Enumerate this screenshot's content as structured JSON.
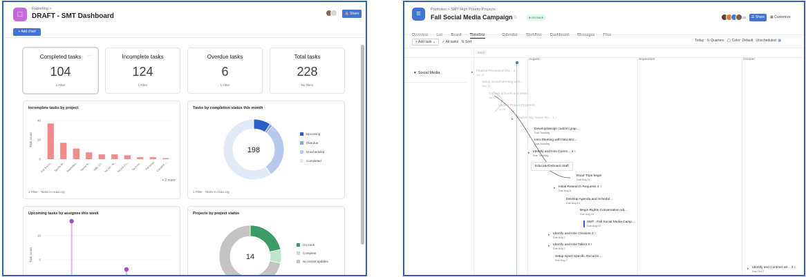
{
  "dashboard": {
    "breadcrumb": "Reporting >",
    "title": "DRAFT - SMT Dashboard",
    "share_label": "Share",
    "add_chart_label": "+ Add chart",
    "stats": [
      {
        "label": "Completed tasks",
        "value": "104",
        "filter": "1 Filter"
      },
      {
        "label": "Incomplete tasks",
        "value": "124",
        "filter": "1 Filter"
      },
      {
        "label": "Overdue tasks",
        "value": "6",
        "filter": "1 Filter"
      },
      {
        "label": "Total tasks",
        "value": "228",
        "filter": "No filters"
      }
    ],
    "incomplete_card": {
      "title": "Incomplete tasks by project",
      "footer": "1 Filter · Tasks in ncaa.org",
      "more": "+ 2 more"
    },
    "status_card": {
      "title": "Tasks by completion status this month",
      "footer": "1 Filter · Tasks in ncaa.org"
    },
    "upcoming_card": {
      "title": "Upcoming tasks by assignee this week"
    },
    "projects_card": {
      "title": "Projects by project status"
    }
  },
  "chart_data": [
    {
      "type": "bar",
      "title": "Incomplete tasks by project",
      "ylabel": "Task count",
      "ylim": [
        0,
        40
      ],
      "yticks": [
        0,
        20,
        40
      ],
      "categories": [
        "Fall Socia...",
        "Sports M...",
        "Basketba...",
        "Name N...",
        "NBL Co...",
        "NCAA - N...",
        "NCAA Co...",
        "Technol...",
        "Personal",
        "Creative ..."
      ],
      "values": [
        37,
        17,
        11,
        7,
        5,
        5,
        4,
        2,
        2,
        1
      ],
      "color": "#f28b8b"
    },
    {
      "type": "pie",
      "title": "Tasks by completion status this month",
      "total": "198",
      "labels": [
        "Upcoming",
        "Overdue",
        "Unscheduled",
        "Completed"
      ],
      "values": [
        18,
        3,
        59,
        118
      ],
      "colors": [
        "#2b5fc4",
        "#8aa3e0",
        "#b9c9ee",
        "#e3e9f7"
      ]
    },
    {
      "type": "scatter",
      "title": "Upcoming tasks by assignee this week",
      "ylabel": "Task count",
      "ylim": [
        0,
        12
      ],
      "yticks": [
        0,
        5,
        10
      ],
      "x": [
        1,
        2,
        3,
        4,
        5,
        6,
        7
      ],
      "y": [
        0,
        13,
        0,
        0,
        3,
        0,
        1
      ],
      "color": "#a34fc9"
    },
    {
      "type": "pie",
      "title": "Projects by project status",
      "total": "14",
      "labels": [
        "On track",
        "Complete",
        "No recent updates"
      ],
      "values": [
        3,
        1,
        10
      ],
      "colors": [
        "#3d9b6a",
        "#bfe3cf",
        "#c4c4c4"
      ]
    }
  ],
  "timeline": {
    "breadcrumb": "Portfolios > SMT High Priority Projects",
    "title": "Fall Social Media Campaign",
    "status": "On track",
    "avatar_count": "15",
    "share_label": "Share",
    "customize_label": "Customize",
    "tabs": [
      "Overview",
      "List",
      "Board",
      "Timeline",
      "Calendar",
      "Workflow",
      "Dashboard",
      "Messages",
      "Files"
    ],
    "active_tab": "Timeline",
    "toolbar": {
      "add_task": "+ Add task",
      "all_tasks": "All tasks",
      "sort": "Sort",
      "today": "Today",
      "zoom": "Quarters",
      "color": "Color: Default",
      "unscheduled": "Unscheduled"
    },
    "year": "2023",
    "months": [
      "August",
      "September",
      "October"
    ],
    "group": "Social Media",
    "tasks": [
      {
        "name": "Finalize Preseason Ro...",
        "date": "Jun 19",
        "sub": "4",
        "faded": true
      },
      {
        "name": "Setup Social Meeting with...",
        "date": "May 31",
        "faded": true
      },
      {
        "name": "Contact schools and deter...",
        "date": "Jul 7",
        "faded": true
      },
      {
        "name": "Update Project Progress",
        "date": "Jul 24",
        "faded": true
      },
      {
        "name": "Finalize Big Game Ro...",
        "sub": "3",
        "faded": true
      },
      {
        "name": "Develop/design custom grap...",
        "date": "Due Tuesday"
      },
      {
        "name": "Intro Meeting with New Bro...",
        "date": "Due Tuesday"
      },
      {
        "name": "Identify and Hire Comm...",
        "date": "Due Tuesday",
        "sub": "4"
      },
      {
        "name": "Educate/Onboard Staff"
      },
      {
        "name": "Road Trips begin",
        "date": "Due Aug 11"
      },
      {
        "name": "Initial Research Requests",
        "date": "Due Aug 8",
        "sub": "4"
      },
      {
        "name": "Develop Agenda and Schedul...",
        "date": "Due Aug 14"
      },
      {
        "name": "Begin Rights Conversation wit...",
        "date": "Due Aug 15"
      },
      {
        "name": "SMT - Fall Social Media Camp...",
        "date": "Due Aug 15"
      },
      {
        "name": "Identify and Hire Creators",
        "date": "Due Aug 7",
        "sub": "2"
      },
      {
        "name": "Identify and Hire Talent",
        "date": "Due Aug 7",
        "sub": "3"
      },
      {
        "name": "Setup Sport-Specific Recurrin...",
        "date": "Due Aug 7"
      },
      {
        "name": "Identify and Contract wit...",
        "date": "Due Oct 2",
        "sub": "3"
      }
    ]
  }
}
